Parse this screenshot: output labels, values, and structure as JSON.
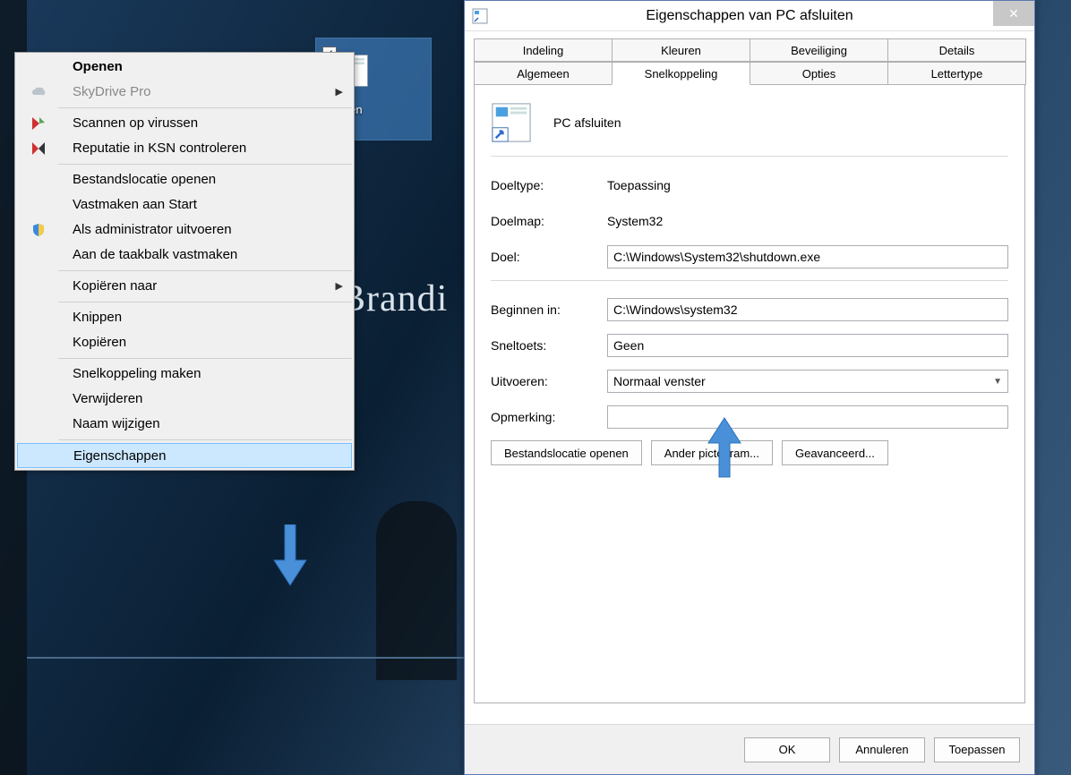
{
  "desktop": {
    "bg_partial_text": "Brandi",
    "shortcut_label": "sluiten"
  },
  "context_menu": {
    "items": [
      {
        "label": "Openen",
        "bold": true
      },
      {
        "label": "SkyDrive Pro",
        "disabled": true,
        "icon": "skydrive",
        "submenu": true
      },
      {
        "sep": true
      },
      {
        "label": "Scannen op virussen",
        "icon": "kav-scan"
      },
      {
        "label": "Reputatie in KSN controleren",
        "icon": "kav-ksn"
      },
      {
        "sep": true
      },
      {
        "label": "Bestandslocatie openen"
      },
      {
        "label": "Vastmaken aan Start"
      },
      {
        "label": "Als administrator uitvoeren",
        "icon": "shield"
      },
      {
        "label": "Aan de taakbalk vastmaken"
      },
      {
        "sep": true
      },
      {
        "label": "Kopiëren naar",
        "submenu": true
      },
      {
        "sep": true
      },
      {
        "label": "Knippen"
      },
      {
        "label": "Kopiëren"
      },
      {
        "sep": true
      },
      {
        "label": "Snelkoppeling maken"
      },
      {
        "label": "Verwijderen"
      },
      {
        "label": "Naam wijzigen"
      },
      {
        "sep": true
      },
      {
        "label": "Eigenschappen",
        "highlight": true
      }
    ]
  },
  "dialog": {
    "title": "Eigenschappen van PC afsluiten",
    "tabs_back": [
      "Indeling",
      "Kleuren",
      "Beveiliging",
      "Details"
    ],
    "tabs_front": [
      "Algemeen",
      "Snelkoppeling",
      "Opties",
      "Lettertype"
    ],
    "active_tab": "Snelkoppeling",
    "shortcut_name": "PC afsluiten",
    "rows": {
      "doeltype_label": "Doeltype:",
      "doeltype_value": "Toepassing",
      "doelmap_label": "Doelmap:",
      "doelmap_value": "System32",
      "doel_label": "Doel:",
      "doel_value": "C:\\Windows\\System32\\shutdown.exe",
      "beginnen_label": "Beginnen in:",
      "beginnen_value": "C:\\Windows\\system32",
      "sneltoets_label": "Sneltoets:",
      "sneltoets_value": "Geen",
      "uitvoeren_label": "Uitvoeren:",
      "uitvoeren_value": "Normaal venster",
      "opmerking_label": "Opmerking:",
      "opmerking_value": ""
    },
    "buttons": {
      "open_file_location": "Bestandslocatie openen",
      "change_icon": "Ander pictogram...",
      "advanced": "Geavanceerd..."
    },
    "footer": {
      "ok": "OK",
      "cancel": "Annuleren",
      "apply": "Toepassen"
    }
  }
}
